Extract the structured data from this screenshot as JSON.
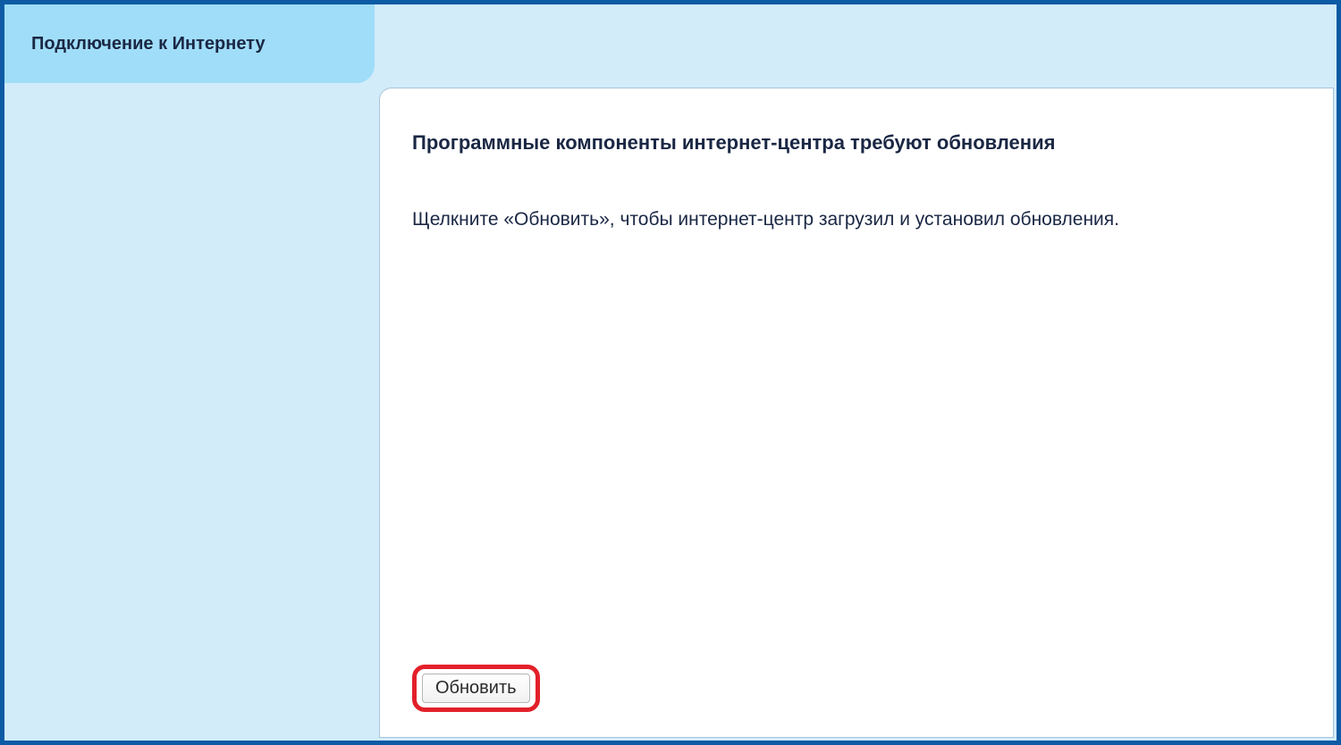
{
  "tab": {
    "title": "Подключение к Интернету"
  },
  "content": {
    "heading": "Программные компоненты интернет-центра требуют обновления",
    "instruction": "Щелкните «Обновить», чтобы интернет-центр загрузил и установил обновления.",
    "update_button_label": "Обновить"
  }
}
